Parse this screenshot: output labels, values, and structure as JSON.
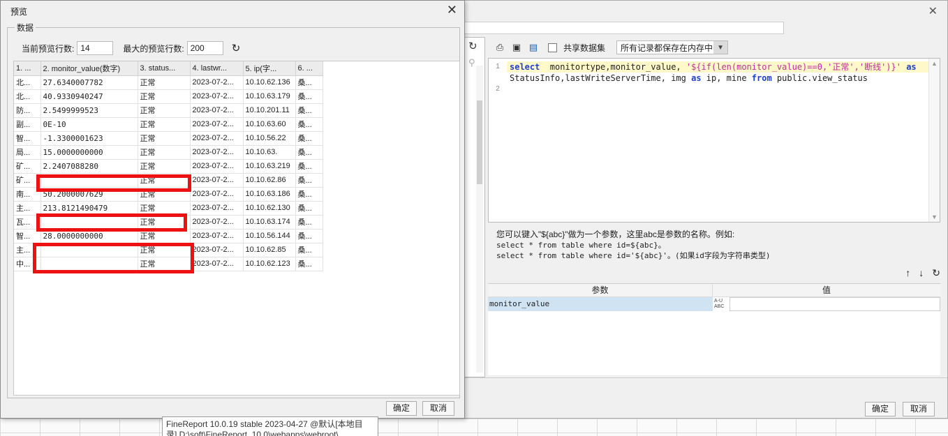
{
  "preview_dialog": {
    "title": "预览",
    "close_glyph": "✕",
    "group_label": "数据",
    "current_rows_label": "当前预览行数:",
    "current_rows_value": "14",
    "max_rows_label": "最大的预览行数:",
    "max_rows_value": "200",
    "refresh_icon": "↻",
    "columns": [
      "1. ...",
      "2. monitor_value(数字)",
      "3. status...",
      "4. lastwr...",
      "5. ip(字...",
      "6. ..."
    ],
    "rows": [
      [
        "北...",
        "27.6340007782",
        "正常",
        "2023-07-2...",
        "10.10.62.136",
        "桑..."
      ],
      [
        "北...",
        "40.9330940247",
        "正常",
        "2023-07-2...",
        "10.10.63.179",
        "桑..."
      ],
      [
        "防...",
        "2.5499999523",
        "正常",
        "2023-07-2...",
        "10.10.201.11",
        "桑..."
      ],
      [
        "副...",
        "0E-10",
        "正常",
        "2023-07-2...",
        "10.10.63.60",
        "桑..."
      ],
      [
        "智...",
        "-1.3300001623",
        "正常",
        "2023-07-2...",
        "10.10.56.22",
        "桑..."
      ],
      [
        "局...",
        "15.0000000000",
        "正常",
        "2023-07-2...",
        "10.10.63.",
        "桑..."
      ],
      [
        "矿...",
        "2.2407088280",
        "正常",
        "2023-07-2...",
        "10.10.63.219",
        "桑..."
      ],
      [
        "矿...",
        "",
        "正常",
        "2023-07-2...",
        "10.10.62.86",
        "桑..."
      ],
      [
        "南...",
        "50.2000007629",
        "正常",
        "2023-07-2...",
        "10.10.63.186",
        "桑..."
      ],
      [
        "主...",
        "213.8121490479",
        "正常",
        "2023-07-2...",
        "10.10.62.130",
        "桑..."
      ],
      [
        "瓦...",
        "",
        "正常",
        "2023-07-2...",
        "10.10.63.174",
        "桑..."
      ],
      [
        "智...",
        "28.0000000000",
        "正常",
        "2023-07-2...",
        "10.10.56.144",
        "桑..."
      ],
      [
        "主...",
        "",
        "正常",
        "2023-07-2...",
        "10.10.62.85",
        "桑..."
      ],
      [
        "中...",
        "",
        "正常",
        "2023-07-2...",
        "10.10.62.123",
        "桑..."
      ]
    ],
    "ok_label": "确定",
    "cancel_label": "取消",
    "highlight_color": "#ee1111"
  },
  "dataset_dialog": {
    "close_glyph": "✕",
    "toolbar": {
      "share_label": "共享数据集",
      "cache_option": "所有记录都保存在内存中"
    },
    "sql_line_numbers": [
      "1",
      "2"
    ],
    "sql_parts": {
      "kw_select": "select",
      "fields": "  monitortype,monitor_value, ",
      "str_expr": "'${if(len(monitor_value)==0,'正常','断线')}'",
      "kw_as": " as",
      "line2a": "StatusInfo,lastWriteServerTime, img ",
      "kw_as2": "as",
      "line2b": " ip, mine ",
      "kw_from": "from",
      "line2c": " public.view_status"
    },
    "hint": {
      "line1": "您可以键入\"${abc}\"做为一个参数，这里abc是参数的名称。例如:",
      "line2": "select * from table where id=${abc}。",
      "line3": "select * from table where id='${abc}'。(如果id字段为字符串类型)"
    },
    "param_table": {
      "col_param": "参数",
      "col_value": "值",
      "rows": [
        {
          "name": "monitor_value",
          "type_icon": "A-U ABC",
          "value": ""
        }
      ]
    },
    "ok_label": "确定",
    "cancel_label": "取消",
    "accent_color": "#1f3fd0",
    "string_color": "#c42c9c"
  },
  "tooltip": {
    "line1": "FineReport 10.0.19 stable 2023-04-27 @默认[本地目",
    "line2": "录]    D:\\soft\\FineReport_10.0\\webapps\\webroot\\"
  }
}
